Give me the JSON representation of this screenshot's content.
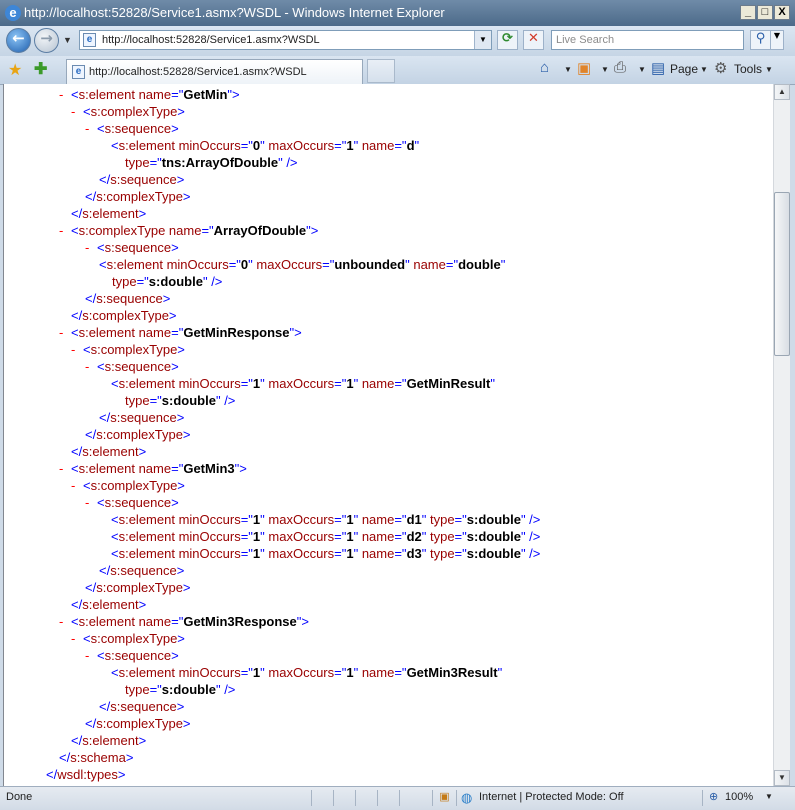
{
  "window": {
    "title": "http://localhost:52828/Service1.asmx?WSDL - Windows Internet Explorer",
    "minimize": "_",
    "maximize": "□",
    "close": "X"
  },
  "address_bar": {
    "url": "http://localhost:52828/Service1.asmx?WSDL",
    "search_placeholder": "Live Search"
  },
  "tab": {
    "label": "http://localhost:52828/Service1.asmx?WSDL"
  },
  "command_bar": {
    "page_label": "Page",
    "tools_label": "Tools"
  },
  "xml_lines": [
    {
      "m": "-",
      "parts": [
        [
          "b",
          "<"
        ],
        [
          "t",
          "s:element"
        ],
        [
          "t",
          " name"
        ],
        [
          "b",
          "=\""
        ],
        [
          "v",
          "GetMin"
        ],
        [
          "b",
          "\">"
        ]
      ]
    },
    {
      "m": "-",
      "parts": [
        [
          "b",
          "<"
        ],
        [
          "t",
          "s:complexType"
        ],
        [
          "b",
          ">"
        ]
      ]
    },
    {
      "m": "-",
      "parts": [
        [
          "b",
          "<"
        ],
        [
          "t",
          "s:sequence"
        ],
        [
          "b",
          ">"
        ]
      ]
    },
    {
      "m": "",
      "parts": [
        [
          "b",
          "<"
        ],
        [
          "t",
          "s:element"
        ],
        [
          "t",
          " minOccurs"
        ],
        [
          "b",
          "=\""
        ],
        [
          "v",
          "0"
        ],
        [
          "b",
          "\""
        ],
        [
          "t",
          " maxOccurs"
        ],
        [
          "b",
          "=\""
        ],
        [
          "v",
          "1"
        ],
        [
          "b",
          "\""
        ],
        [
          "t",
          " name"
        ],
        [
          "b",
          "=\""
        ],
        [
          "v",
          "d"
        ],
        [
          "b",
          "\""
        ]
      ]
    },
    {
      "m": "",
      "parts": [
        [
          "t",
          "type"
        ],
        [
          "b",
          "=\""
        ],
        [
          "v",
          "tns:ArrayOfDouble"
        ],
        [
          "b",
          "\" />"
        ]
      ]
    },
    {
      "m": "",
      "parts": [
        [
          "b",
          "</"
        ],
        [
          "t",
          "s:sequence"
        ],
        [
          "b",
          ">"
        ]
      ]
    },
    {
      "m": "",
      "parts": [
        [
          "b",
          "</"
        ],
        [
          "t",
          "s:complexType"
        ],
        [
          "b",
          ">"
        ]
      ]
    },
    {
      "m": "",
      "parts": [
        [
          "b",
          "</"
        ],
        [
          "t",
          "s:element"
        ],
        [
          "b",
          ">"
        ]
      ]
    },
    {
      "m": "-",
      "parts": [
        [
          "b",
          "<"
        ],
        [
          "t",
          "s:complexType"
        ],
        [
          "t",
          " name"
        ],
        [
          "b",
          "=\""
        ],
        [
          "v",
          "ArrayOfDouble"
        ],
        [
          "b",
          "\">"
        ]
      ]
    },
    {
      "m": "-",
      "parts": [
        [
          "b",
          "<"
        ],
        [
          "t",
          "s:sequence"
        ],
        [
          "b",
          ">"
        ]
      ]
    },
    {
      "m": "",
      "parts": [
        [
          "b",
          "<"
        ],
        [
          "t",
          "s:element"
        ],
        [
          "t",
          " minOccurs"
        ],
        [
          "b",
          "=\""
        ],
        [
          "v",
          "0"
        ],
        [
          "b",
          "\""
        ],
        [
          "t",
          " maxOccurs"
        ],
        [
          "b",
          "=\""
        ],
        [
          "v",
          "unbounded"
        ],
        [
          "b",
          "\""
        ],
        [
          "t",
          " name"
        ],
        [
          "b",
          "=\""
        ],
        [
          "v",
          "double"
        ],
        [
          "b",
          "\""
        ]
      ]
    },
    {
      "m": "",
      "parts": [
        [
          "t",
          "type"
        ],
        [
          "b",
          "=\""
        ],
        [
          "v",
          "s:double"
        ],
        [
          "b",
          "\" />"
        ]
      ]
    },
    {
      "m": "",
      "parts": [
        [
          "b",
          "</"
        ],
        [
          "t",
          "s:sequence"
        ],
        [
          "b",
          ">"
        ]
      ]
    },
    {
      "m": "",
      "parts": [
        [
          "b",
          "</"
        ],
        [
          "t",
          "s:complexType"
        ],
        [
          "b",
          ">"
        ]
      ]
    },
    {
      "m": "-",
      "parts": [
        [
          "b",
          "<"
        ],
        [
          "t",
          "s:element"
        ],
        [
          "t",
          " name"
        ],
        [
          "b",
          "=\""
        ],
        [
          "v",
          "GetMinResponse"
        ],
        [
          "b",
          "\">"
        ]
      ]
    },
    {
      "m": "-",
      "parts": [
        [
          "b",
          "<"
        ],
        [
          "t",
          "s:complexType"
        ],
        [
          "b",
          ">"
        ]
      ]
    },
    {
      "m": "-",
      "parts": [
        [
          "b",
          "<"
        ],
        [
          "t",
          "s:sequence"
        ],
        [
          "b",
          ">"
        ]
      ]
    },
    {
      "m": "",
      "parts": [
        [
          "b",
          "<"
        ],
        [
          "t",
          "s:element"
        ],
        [
          "t",
          " minOccurs"
        ],
        [
          "b",
          "=\""
        ],
        [
          "v",
          "1"
        ],
        [
          "b",
          "\""
        ],
        [
          "t",
          " maxOccurs"
        ],
        [
          "b",
          "=\""
        ],
        [
          "v",
          "1"
        ],
        [
          "b",
          "\""
        ],
        [
          "t",
          " name"
        ],
        [
          "b",
          "=\""
        ],
        [
          "v",
          "GetMinResult"
        ],
        [
          "b",
          "\""
        ]
      ]
    },
    {
      "m": "",
      "parts": [
        [
          "t",
          "type"
        ],
        [
          "b",
          "=\""
        ],
        [
          "v",
          "s:double"
        ],
        [
          "b",
          "\" />"
        ]
      ]
    },
    {
      "m": "",
      "parts": [
        [
          "b",
          "</"
        ],
        [
          "t",
          "s:sequence"
        ],
        [
          "b",
          ">"
        ]
      ]
    },
    {
      "m": "",
      "parts": [
        [
          "b",
          "</"
        ],
        [
          "t",
          "s:complexType"
        ],
        [
          "b",
          ">"
        ]
      ]
    },
    {
      "m": "",
      "parts": [
        [
          "b",
          "</"
        ],
        [
          "t",
          "s:element"
        ],
        [
          "b",
          ">"
        ]
      ]
    },
    {
      "m": "-",
      "parts": [
        [
          "b",
          "<"
        ],
        [
          "t",
          "s:element"
        ],
        [
          "t",
          " name"
        ],
        [
          "b",
          "=\""
        ],
        [
          "v",
          "GetMin3"
        ],
        [
          "b",
          "\">"
        ]
      ]
    },
    {
      "m": "-",
      "parts": [
        [
          "b",
          "<"
        ],
        [
          "t",
          "s:complexType"
        ],
        [
          "b",
          ">"
        ]
      ]
    },
    {
      "m": "-",
      "parts": [
        [
          "b",
          "<"
        ],
        [
          "t",
          "s:sequence"
        ],
        [
          "b",
          ">"
        ]
      ]
    },
    {
      "m": "",
      "parts": [
        [
          "b",
          "<"
        ],
        [
          "t",
          "s:element"
        ],
        [
          "t",
          " minOccurs"
        ],
        [
          "b",
          "=\""
        ],
        [
          "v",
          "1"
        ],
        [
          "b",
          "\""
        ],
        [
          "t",
          " maxOccurs"
        ],
        [
          "b",
          "=\""
        ],
        [
          "v",
          "1"
        ],
        [
          "b",
          "\""
        ],
        [
          "t",
          " name"
        ],
        [
          "b",
          "=\""
        ],
        [
          "v",
          "d1"
        ],
        [
          "b",
          "\""
        ],
        [
          "t",
          " type"
        ],
        [
          "b",
          "=\""
        ],
        [
          "v",
          "s:double"
        ],
        [
          "b",
          "\" />"
        ]
      ]
    },
    {
      "m": "",
      "parts": [
        [
          "b",
          "<"
        ],
        [
          "t",
          "s:element"
        ],
        [
          "t",
          " minOccurs"
        ],
        [
          "b",
          "=\""
        ],
        [
          "v",
          "1"
        ],
        [
          "b",
          "\""
        ],
        [
          "t",
          " maxOccurs"
        ],
        [
          "b",
          "=\""
        ],
        [
          "v",
          "1"
        ],
        [
          "b",
          "\""
        ],
        [
          "t",
          " name"
        ],
        [
          "b",
          "=\""
        ],
        [
          "v",
          "d2"
        ],
        [
          "b",
          "\""
        ],
        [
          "t",
          " type"
        ],
        [
          "b",
          "=\""
        ],
        [
          "v",
          "s:double"
        ],
        [
          "b",
          "\" />"
        ]
      ]
    },
    {
      "m": "",
      "parts": [
        [
          "b",
          "<"
        ],
        [
          "t",
          "s:element"
        ],
        [
          "t",
          " minOccurs"
        ],
        [
          "b",
          "=\""
        ],
        [
          "v",
          "1"
        ],
        [
          "b",
          "\""
        ],
        [
          "t",
          " maxOccurs"
        ],
        [
          "b",
          "=\""
        ],
        [
          "v",
          "1"
        ],
        [
          "b",
          "\""
        ],
        [
          "t",
          " name"
        ],
        [
          "b",
          "=\""
        ],
        [
          "v",
          "d3"
        ],
        [
          "b",
          "\""
        ],
        [
          "t",
          " type"
        ],
        [
          "b",
          "=\""
        ],
        [
          "v",
          "s:double"
        ],
        [
          "b",
          "\" />"
        ]
      ]
    },
    {
      "m": "",
      "parts": [
        [
          "b",
          "</"
        ],
        [
          "t",
          "s:sequence"
        ],
        [
          "b",
          ">"
        ]
      ]
    },
    {
      "m": "",
      "parts": [
        [
          "b",
          "</"
        ],
        [
          "t",
          "s:complexType"
        ],
        [
          "b",
          ">"
        ]
      ]
    },
    {
      "m": "",
      "parts": [
        [
          "b",
          "</"
        ],
        [
          "t",
          "s:element"
        ],
        [
          "b",
          ">"
        ]
      ]
    },
    {
      "m": "-",
      "parts": [
        [
          "b",
          "<"
        ],
        [
          "t",
          "s:element"
        ],
        [
          "t",
          " name"
        ],
        [
          "b",
          "=\""
        ],
        [
          "v",
          "GetMin3Response"
        ],
        [
          "b",
          "\">"
        ]
      ]
    },
    {
      "m": "-",
      "parts": [
        [
          "b",
          "<"
        ],
        [
          "t",
          "s:complexType"
        ],
        [
          "b",
          ">"
        ]
      ]
    },
    {
      "m": "-",
      "parts": [
        [
          "b",
          "<"
        ],
        [
          "t",
          "s:sequence"
        ],
        [
          "b",
          ">"
        ]
      ]
    },
    {
      "m": "",
      "parts": [
        [
          "b",
          "<"
        ],
        [
          "t",
          "s:element"
        ],
        [
          "t",
          " minOccurs"
        ],
        [
          "b",
          "=\""
        ],
        [
          "v",
          "1"
        ],
        [
          "b",
          "\""
        ],
        [
          "t",
          " maxOccurs"
        ],
        [
          "b",
          "=\""
        ],
        [
          "v",
          "1"
        ],
        [
          "b",
          "\""
        ],
        [
          "t",
          " name"
        ],
        [
          "b",
          "=\""
        ],
        [
          "v",
          "GetMin3Result"
        ],
        [
          "b",
          "\""
        ]
      ]
    },
    {
      "m": "",
      "parts": [
        [
          "t",
          "type"
        ],
        [
          "b",
          "=\""
        ],
        [
          "v",
          "s:double"
        ],
        [
          "b",
          "\" />"
        ]
      ]
    },
    {
      "m": "",
      "parts": [
        [
          "b",
          "</"
        ],
        [
          "t",
          "s:sequence"
        ],
        [
          "b",
          ">"
        ]
      ]
    },
    {
      "m": "",
      "parts": [
        [
          "b",
          "</"
        ],
        [
          "t",
          "s:complexType"
        ],
        [
          "b",
          ">"
        ]
      ]
    },
    {
      "m": "",
      "parts": [
        [
          "b",
          "</"
        ],
        [
          "t",
          "s:element"
        ],
        [
          "b",
          ">"
        ]
      ]
    },
    {
      "m": "",
      "parts": [
        [
          "b",
          "</"
        ],
        [
          "t",
          "s:schema"
        ],
        [
          "b",
          ">"
        ]
      ]
    },
    {
      "m": "",
      "parts": [
        [
          "b",
          "</"
        ],
        [
          "t",
          "wsdl:types"
        ],
        [
          "b",
          ">"
        ]
      ]
    }
  ],
  "status_bar": {
    "status": "Done",
    "zone": "Internet | Protected Mode: Off",
    "zoom": "100%"
  }
}
